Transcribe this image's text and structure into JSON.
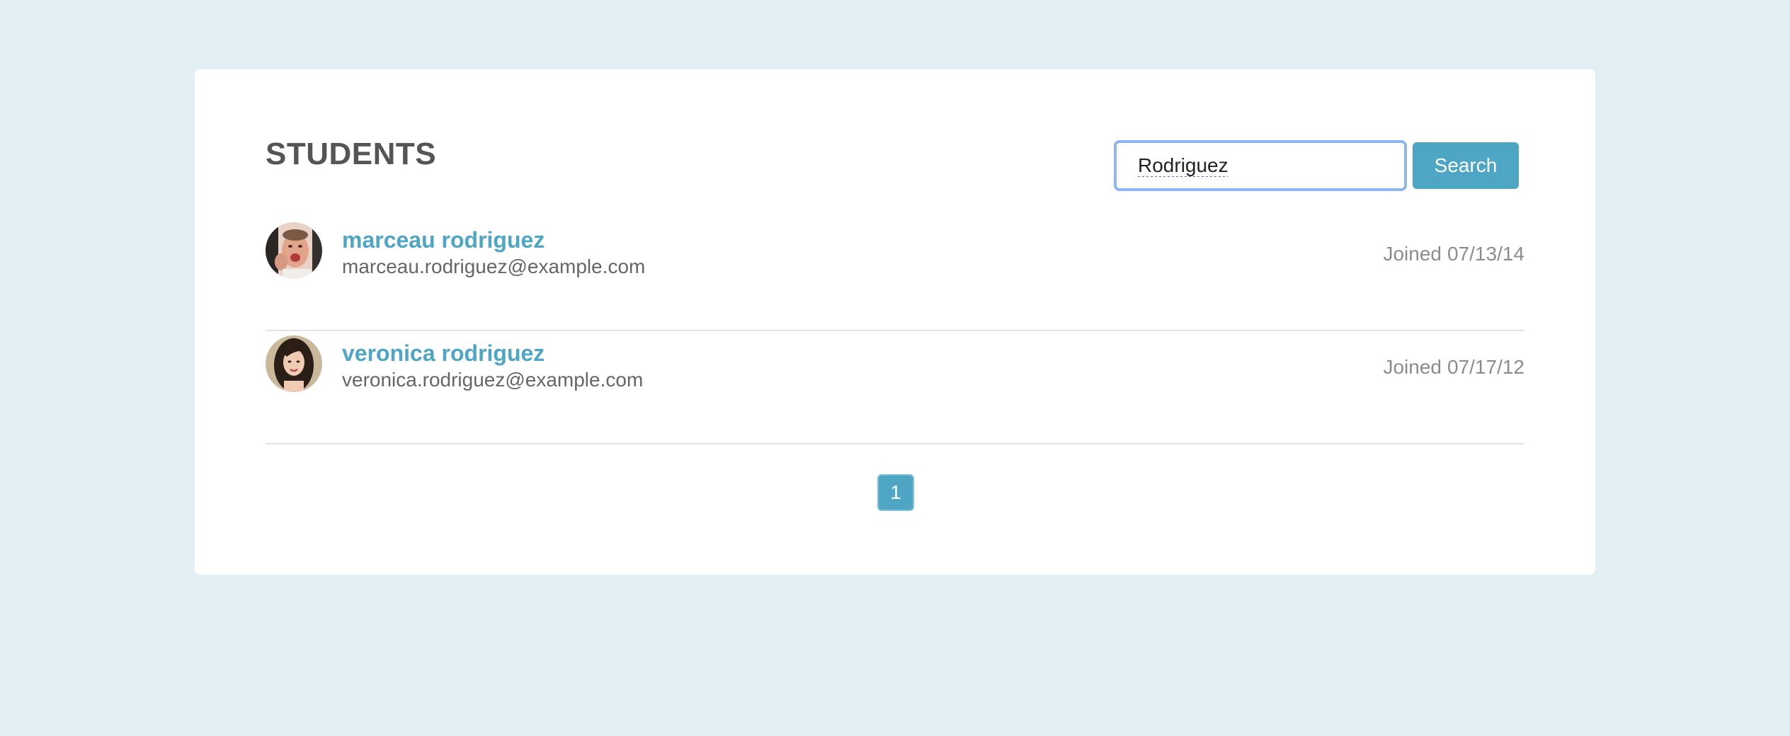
{
  "header": {
    "title": "STUDENTS"
  },
  "search": {
    "value": "Rodriguez",
    "button_label": "Search"
  },
  "students": [
    {
      "name": "marceau rodriguez",
      "email": "marceau.rodriguez@example.com",
      "joined_label": "Joined",
      "joined_date": "07/13/14",
      "avatar": "avatar-photo"
    },
    {
      "name": "veronica rodriguez",
      "email": "veronica.rodriguez@example.com",
      "joined_label": "Joined",
      "joined_date": "07/17/12",
      "avatar": "avatar-photo"
    }
  ],
  "pagination": {
    "pages": [
      "1"
    ],
    "current": "1"
  },
  "colors": {
    "background": "#e2f0f5",
    "accent": "#4fa5c4",
    "title": "#555555",
    "muted": "#8c8c8c"
  }
}
